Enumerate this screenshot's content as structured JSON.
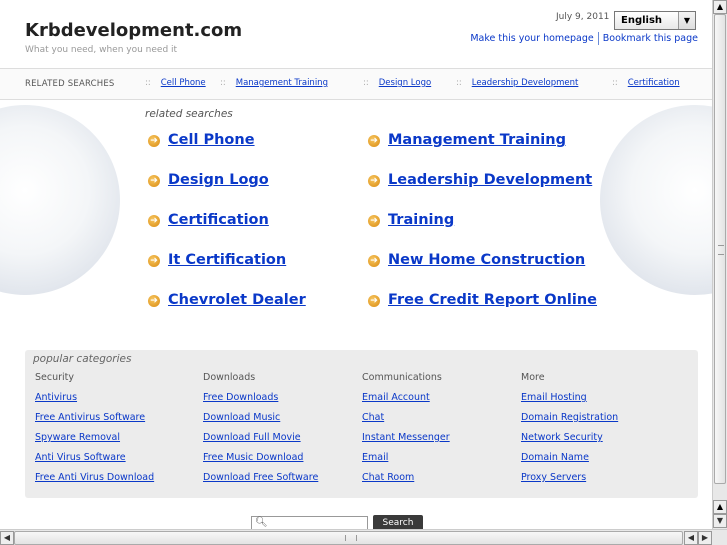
{
  "header": {
    "site_title": "Krbdevelopment.com",
    "tagline": "What you need, when you need it",
    "date": "July 9, 2011",
    "language": "English",
    "make_homepage": "Make this your homepage",
    "bookmark": "Bookmark this page"
  },
  "related_bar": {
    "label": "RELATED SEARCHES",
    "separator": "::",
    "items": [
      "Cell Phone",
      "Management Training",
      "Design Logo",
      "Leadership Development",
      "Certification"
    ]
  },
  "related_searches": {
    "heading": "related searches",
    "links": [
      "Cell Phone",
      "Management Training",
      "Design Logo",
      "Leadership Development",
      "Certification",
      "Training",
      "It Certification",
      "New Home Construction",
      "Chevrolet Dealer",
      "Free Credit Report Online"
    ]
  },
  "popular": {
    "title": "popular categories",
    "columns": [
      {
        "heading": "Security",
        "links": [
          "Antivirus",
          "Free Antivirus Software",
          "Spyware Removal",
          "Anti Virus Software",
          "Free Anti Virus Download"
        ]
      },
      {
        "heading": "Downloads",
        "links": [
          "Free Downloads",
          "Download Music",
          "Download Full Movie",
          "Free Music Download",
          "Download Free Software"
        ]
      },
      {
        "heading": "Communications",
        "links": [
          "Email Account",
          "Chat",
          "Instant Messenger",
          "Email",
          "Chat Room"
        ]
      },
      {
        "heading": "More",
        "links": [
          "Email Hosting",
          "Domain Registration",
          "Network Security",
          "Domain Name",
          "Proxy Servers"
        ]
      }
    ]
  },
  "search": {
    "button_label": "Search",
    "placeholder": ""
  },
  "icons": {
    "arrow": "arrow-right-circle-icon",
    "magnifier": "search-icon",
    "dropdown": "chevron-down-icon"
  },
  "colors": {
    "link": "#0a38c8",
    "arrow_accent": "#e89a1a",
    "panel_bg": "#ececec"
  }
}
